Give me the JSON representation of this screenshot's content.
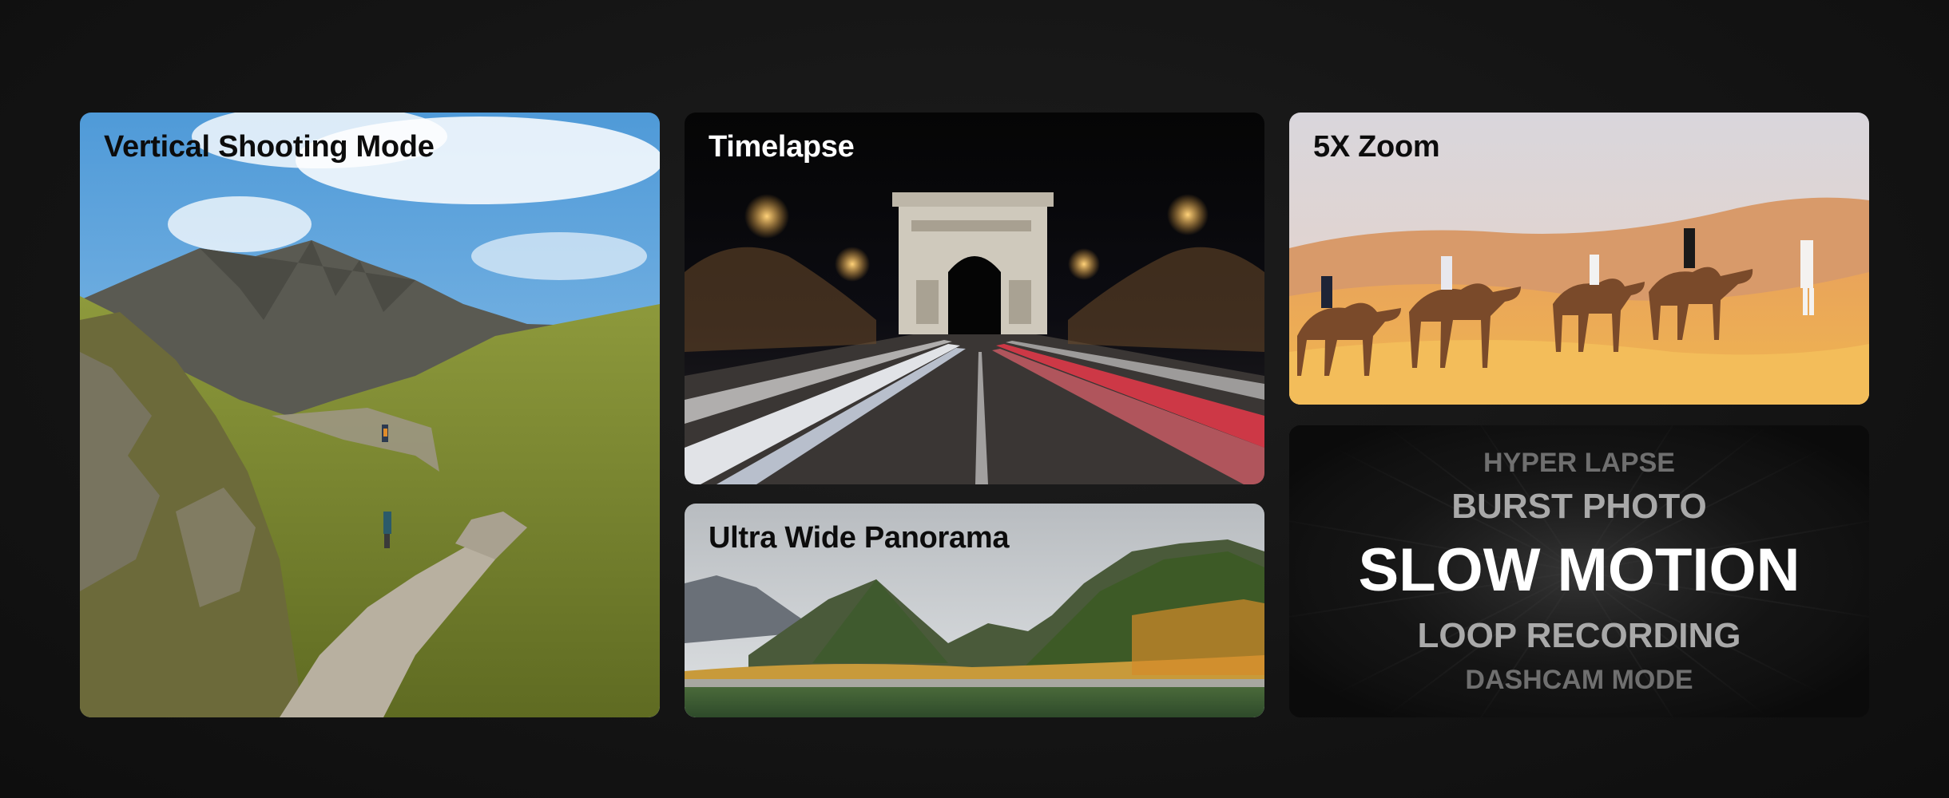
{
  "cards": {
    "vertical": {
      "title": "Vertical Shooting Mode"
    },
    "timelapse": {
      "title": "Timelapse"
    },
    "zoom": {
      "title": "5X Zoom"
    },
    "panorama": {
      "title": "Ultra Wide Panorama"
    }
  },
  "modes": [
    "HYPER LAPSE",
    "BURST PHOTO",
    "SLOW MOTION",
    "LOOP RECORDING",
    "DASHCAM MODE"
  ],
  "colors": {
    "background": "#141414",
    "title_dark": "#0c0c0c",
    "title_light": "#ffffff",
    "mode_active": "#ffffff",
    "mode_mid": "#a9a9a9",
    "mode_far": "#6f6f6f"
  }
}
